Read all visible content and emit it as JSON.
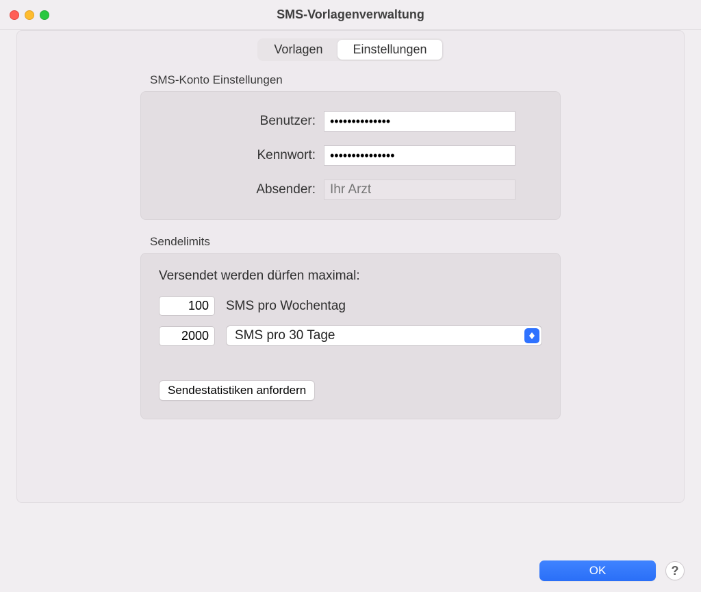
{
  "window": {
    "title": "SMS-Vorlagenverwaltung"
  },
  "tabs": {
    "templates_label": "Vorlagen",
    "settings_label": "Einstellungen"
  },
  "account": {
    "section_title": "SMS-Konto Einstellungen",
    "user_label": "Benutzer:",
    "user_value": "••••••••••••••",
    "password_label": "Kennwort:",
    "password_value": "•••••••••••••••",
    "sender_label": "Absender:",
    "sender_placeholder": "Ihr Arzt"
  },
  "limits": {
    "section_title": "Sendelimits",
    "intro": "Versendet werden dürfen maximal:",
    "per_day_value": "100",
    "per_day_label": "SMS pro Wochentag",
    "per_period_value": "2000",
    "period_selected": "SMS pro 30 Tage",
    "stats_button": "Sendestatistiken anfordern"
  },
  "footer": {
    "ok_label": "OK",
    "help_label": "?"
  }
}
